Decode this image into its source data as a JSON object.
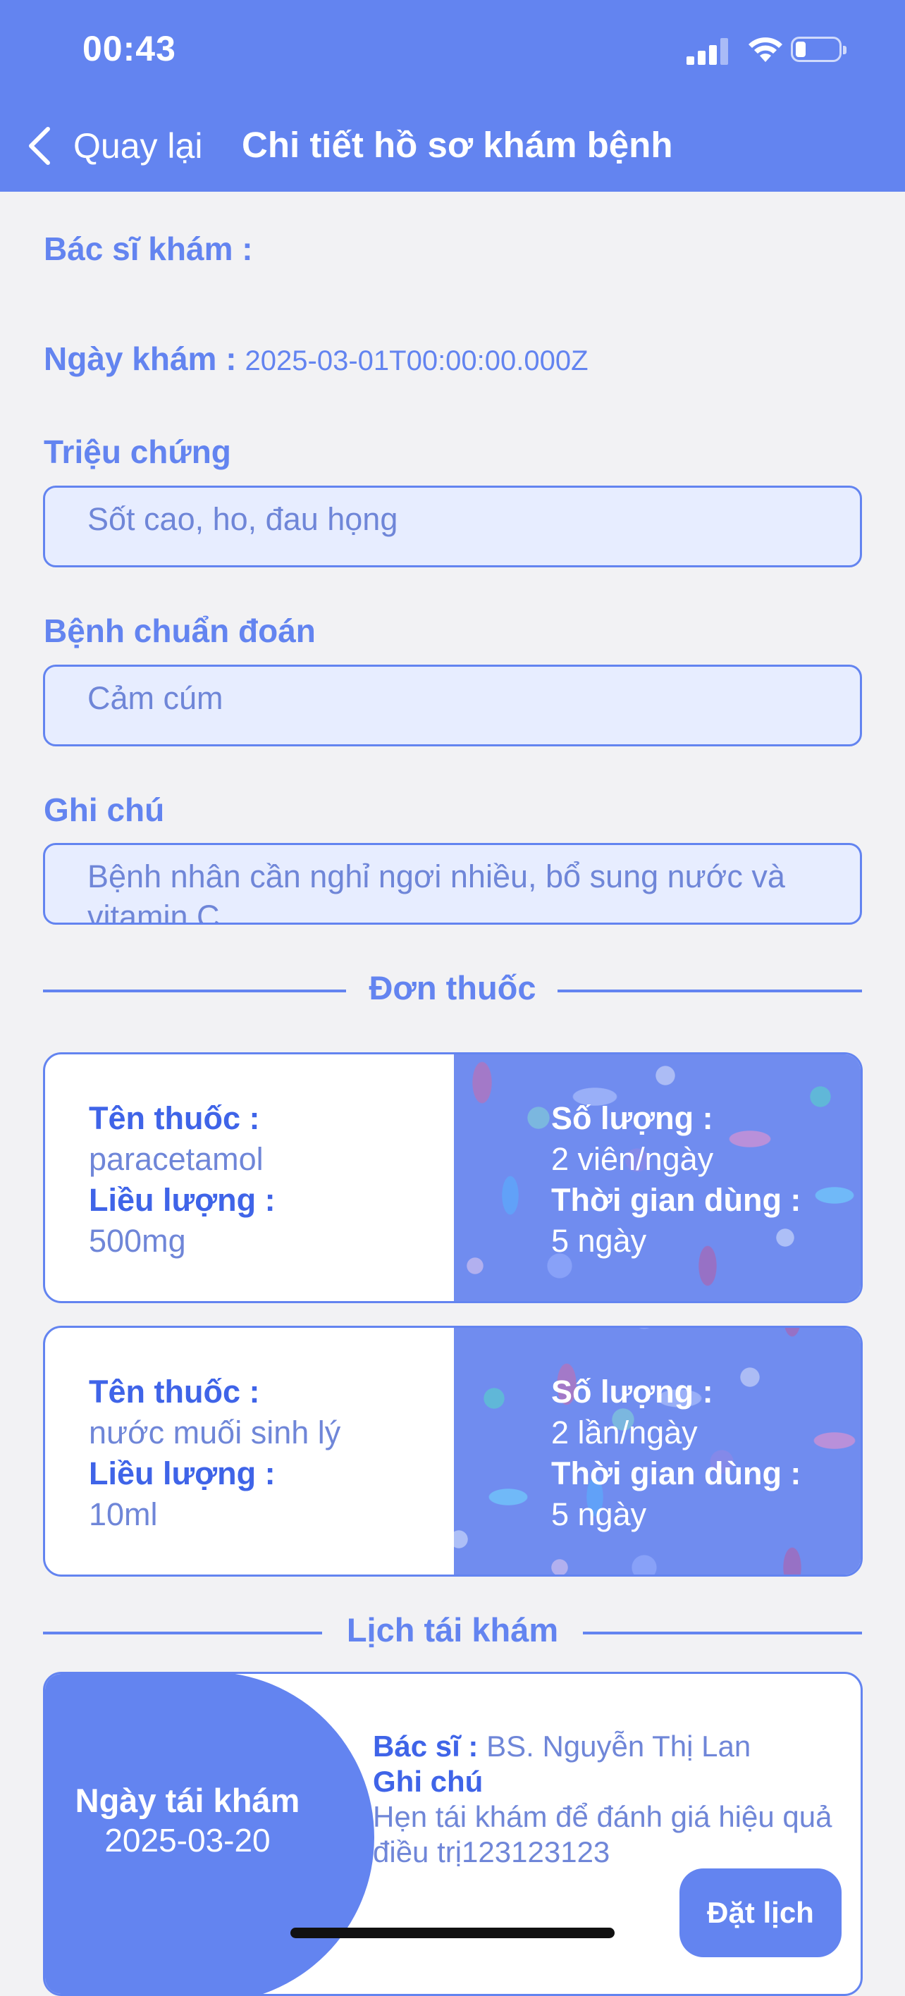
{
  "status_bar": {
    "time": "00:43"
  },
  "header": {
    "back_label": "Quay lại",
    "title": "Chi tiết hồ sơ khám bệnh"
  },
  "record": {
    "doctor_label": "Bác sĩ khám :",
    "date_label": "Ngày khám :",
    "date_value": "2025-03-01T00:00:00.000Z",
    "symptoms_label": "Triệu chứng",
    "symptoms_value": "Sốt cao, ho, đau họng",
    "diagnosis_label": "Bệnh chuẩn đoán",
    "diagnosis_value": "Cảm cúm",
    "notes_label": "Ghi chú",
    "notes_value": "Bệnh nhân cần nghỉ ngơi nhiều, bổ sung nước và vitamin C."
  },
  "prescription": {
    "section_title": "Đơn thuốc",
    "keys": {
      "name": "Tên thuốc :",
      "dosage": "Liều lượng :",
      "quantity": "Số lượng :",
      "duration": "Thời gian dùng :"
    },
    "items": [
      {
        "name": "paracetamol",
        "dosage": "500mg",
        "quantity": "2 viên/ngày",
        "duration": "5 ngày"
      },
      {
        "name": "nước muối sinh lý",
        "dosage": "10ml",
        "quantity": "2 lần/ngày",
        "duration": "5 ngày"
      }
    ]
  },
  "followup": {
    "section_title": "Lịch tái khám",
    "date_label": "Ngày tái khám",
    "date_value": "2025-03-20",
    "doctor_key": "Bác sĩ :",
    "doctor_value": "BS. Nguyễn Thị Lan",
    "note_key": "Ghi chú",
    "note_value": "Hẹn tái khám để đánh giá hiệu quả điều trị123123123",
    "book_label": "Đặt lịch"
  },
  "colors": {
    "primary": "#6384f0",
    "field_bg": "#e7edff",
    "page_bg": "#f2f2f4"
  },
  "icons": [
    "signal-icon",
    "wifi-icon",
    "battery-icon",
    "chevron-left-icon"
  ]
}
